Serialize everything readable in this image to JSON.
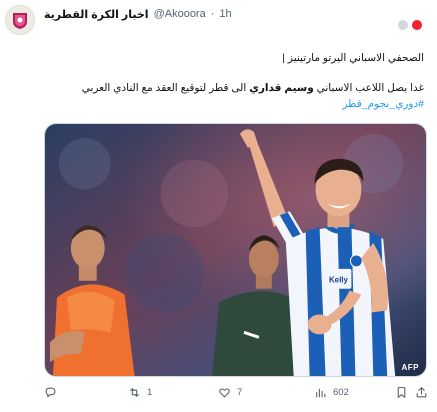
{
  "author": {
    "name": "اخبار الكرة القطرية",
    "handle": "@Akooora",
    "separator": "·",
    "time": "1h"
  },
  "tweet": {
    "line1": "الصحفي الاسباني اليرتو مارتينيز |",
    "line2_before": "غدا يصل اللاعب الاسباني ",
    "line2_bold": "وسيم قداري",
    "line2_after": " الى قطر لتوقيع العقد مع النادي العربي",
    "hashtag": "#دوري_نجوم_قطر"
  },
  "media": {
    "credit": "AFP",
    "shirt_text": "Kelly"
  },
  "actions": {
    "reply_count": "",
    "retweet_count": "1",
    "like_count": "7",
    "views_count": "602"
  },
  "icons": {
    "reply": "reply-icon",
    "retweet": "retweet-icon",
    "like": "heart-icon",
    "views": "views-icon",
    "bookmark": "bookmark-icon",
    "share": "share-icon"
  },
  "colors": {
    "link": "#1d9bf0",
    "secondary_text": "#536471",
    "status_dot_grey": "#cfd9de",
    "status_dot_red": "#f4212e"
  }
}
